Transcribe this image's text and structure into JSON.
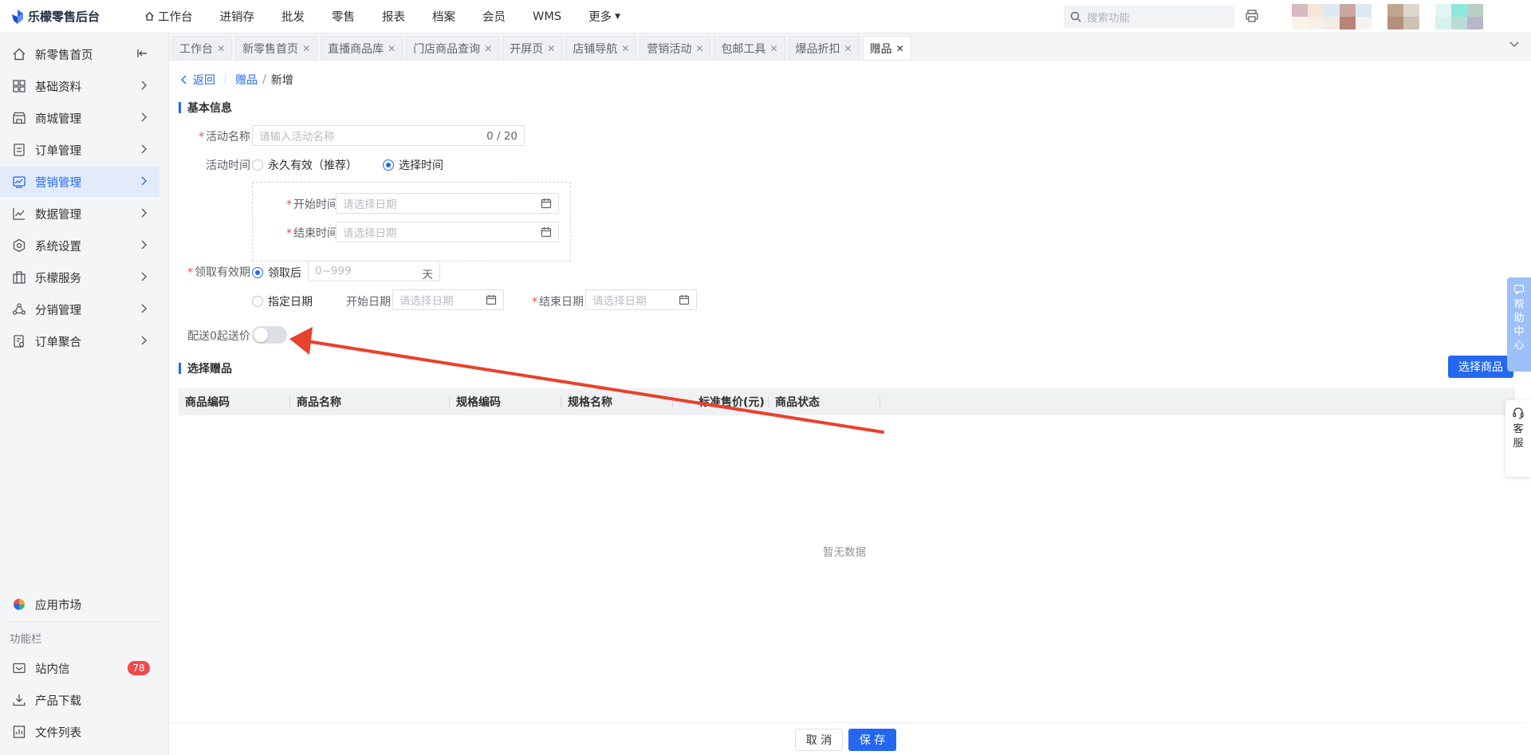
{
  "brand": {
    "name": "乐檬零售后台"
  },
  "topnav": [
    {
      "label": "工作台",
      "icon": "home-icon"
    },
    {
      "label": "进销存"
    },
    {
      "label": "批发"
    },
    {
      "label": "零售"
    },
    {
      "label": "报表"
    },
    {
      "label": "档案"
    },
    {
      "label": "会员"
    },
    {
      "label": "WMS"
    },
    {
      "label": "更多",
      "icon": "caret-down-icon"
    }
  ],
  "search": {
    "placeholder": "搜索功能"
  },
  "colors": {
    "primary": "#2468f2",
    "danger": "#f04a4a",
    "annotation_arrow": "#e8412c",
    "help_float": "#9cc0f7"
  },
  "sidebar": {
    "items": [
      {
        "label": "新零售首页",
        "icon": "home-icon"
      },
      {
        "label": "基础资料",
        "icon": "grid-icon"
      },
      {
        "label": "商城管理",
        "icon": "store-icon"
      },
      {
        "label": "订单管理",
        "icon": "order-icon"
      },
      {
        "label": "营销管理",
        "icon": "marketing-icon",
        "active": true
      },
      {
        "label": "数据管理",
        "icon": "chart-line-icon"
      },
      {
        "label": "系统设置",
        "icon": "settings-icon"
      },
      {
        "label": "乐檬服务",
        "icon": "briefcase-icon"
      },
      {
        "label": "分销管理",
        "icon": "distribution-icon"
      },
      {
        "label": "订单聚合",
        "icon": "aggregate-icon"
      }
    ],
    "app_market": "应用市场",
    "section_caption": "功能栏",
    "bottom_items": [
      {
        "label": "站内信",
        "icon": "mail-icon",
        "badge": "78"
      },
      {
        "label": "产品下载",
        "icon": "download-icon"
      },
      {
        "label": "文件列表",
        "icon": "file-list-icon"
      }
    ]
  },
  "tabs": [
    {
      "label": "工作台"
    },
    {
      "label": "新零售首页"
    },
    {
      "label": "直播商品库"
    },
    {
      "label": "门店商品查询"
    },
    {
      "label": "开屏页"
    },
    {
      "label": "店铺导航"
    },
    {
      "label": "营销活动"
    },
    {
      "label": "包邮工具"
    },
    {
      "label": "爆品折扣"
    },
    {
      "label": "赠品",
      "active": true
    }
  ],
  "breadcrumb": {
    "back": "返回",
    "parent": "赠品",
    "separator": "/",
    "current": "新增"
  },
  "basic_info": {
    "title": "基本信息",
    "activity_name": {
      "label": "活动名称",
      "placeholder": "请输入活动名称",
      "counter": "0 / 20"
    },
    "activity_time": {
      "label": "活动时间",
      "options": [
        "永久有效（推荐）",
        "选择时间"
      ],
      "selected": "选择时间",
      "start_label": "开始时间",
      "end_label": "结束时间",
      "date_placeholder": "请选择日期"
    },
    "validity": {
      "label": "领取有效期",
      "option_after": "领取后",
      "days_placeholder": "0~999",
      "days_unit": "天",
      "option_date": "指定日期",
      "start_label": "开始日期",
      "end_label": "结束日期",
      "date_placeholder": "请选择日期",
      "selected": "领取后"
    },
    "delivery": {
      "label": "配送0起送价",
      "enabled": false
    }
  },
  "gift": {
    "title": "选择赠品",
    "select_button": "选择商品",
    "columns": [
      "商品编码",
      "商品名称",
      "规格编码",
      "规格名称",
      "标准售价(元)",
      "商品状态"
    ],
    "rows": [],
    "empty_text": "暂无数据"
  },
  "footer": {
    "cancel": "取 消",
    "save": "保 存"
  },
  "floating": {
    "help": [
      "帮",
      "助",
      "中",
      "心"
    ],
    "service": [
      "客",
      "服"
    ]
  }
}
